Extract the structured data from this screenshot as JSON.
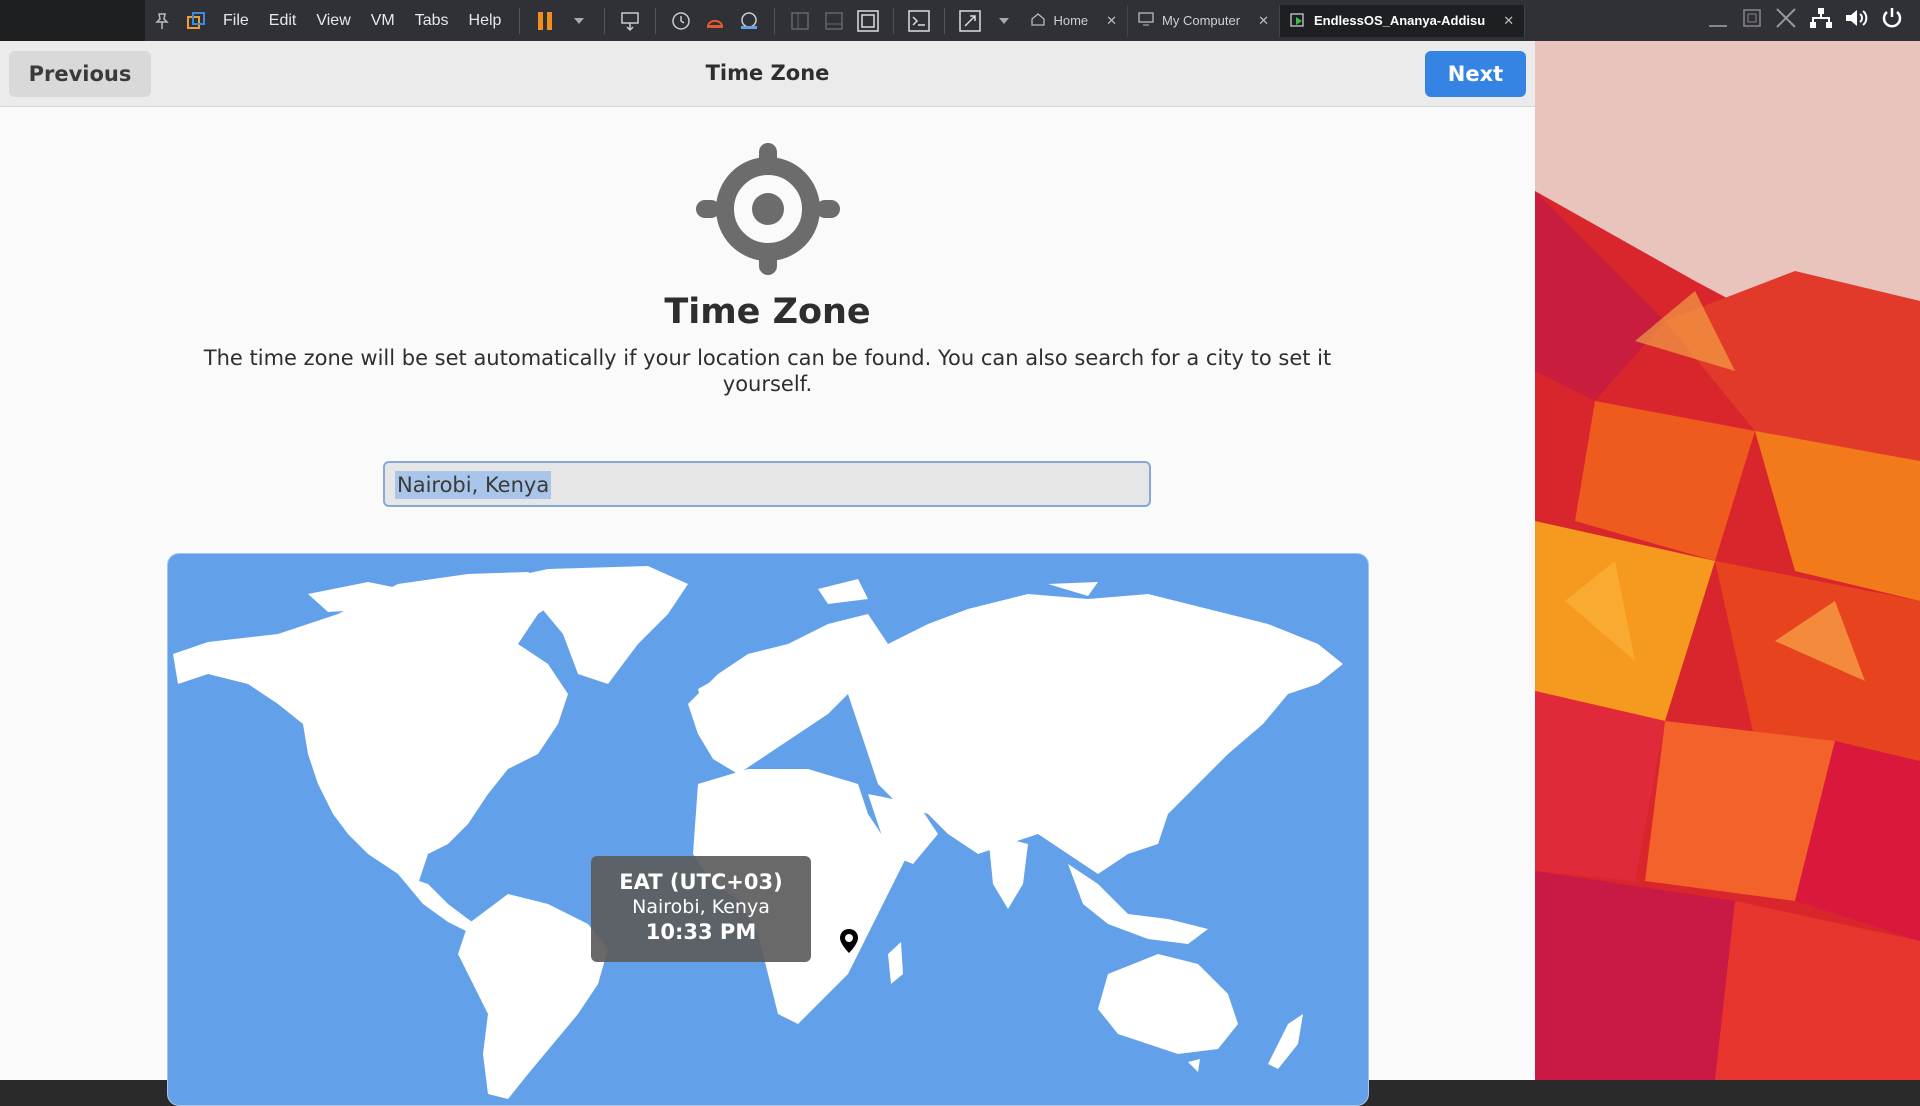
{
  "vm_toolbar": {
    "menus": [
      "File",
      "Edit",
      "View",
      "VM",
      "Tabs",
      "Help"
    ],
    "tabs": [
      {
        "label": "Home",
        "active": false
      },
      {
        "label": "My Computer",
        "active": false
      },
      {
        "label": "EndlessOS_Ananya-Addisu",
        "active": true
      }
    ]
  },
  "header": {
    "previous_label": "Previous",
    "title": "Time Zone",
    "next_label": "Next"
  },
  "page": {
    "icon": "location-crosshair-icon",
    "title": "Time Zone",
    "description": "The time zone will be set automatically if your location can be found. You can also search for a city to set it yourself."
  },
  "search": {
    "value": "Nairobi, Kenya"
  },
  "map": {
    "tooltip": {
      "timezone": "EAT (UTC+03)",
      "city": "Nairobi, Kenya",
      "time": "10:33 PM"
    }
  },
  "colors": {
    "accent": "#3584e4",
    "map_ocean": "#62a0ea",
    "land": "#ffffff"
  }
}
